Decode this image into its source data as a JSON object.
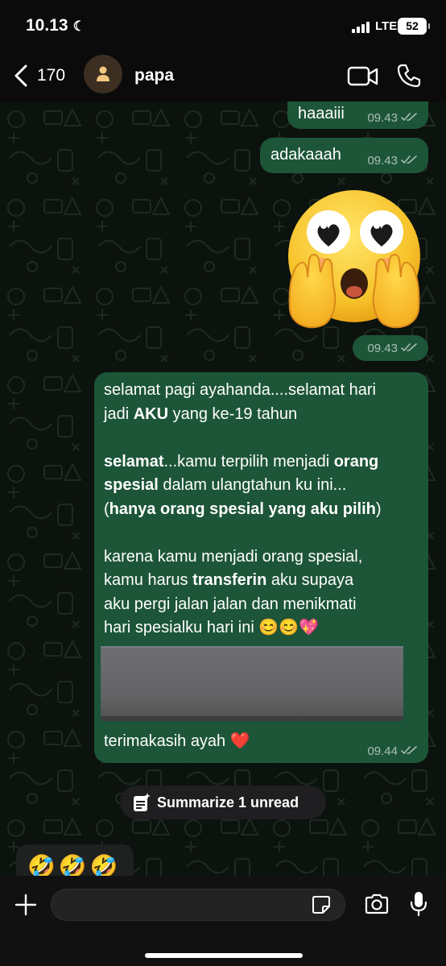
{
  "status_bar": {
    "time": "10.13",
    "network": "LTE",
    "battery": "52",
    "icons": [
      "moon-icon",
      "signal-icon",
      "battery-icon"
    ]
  },
  "header": {
    "back_count": "170",
    "contact_name": "papa",
    "icons": [
      "chevron-left-icon",
      "person-icon",
      "video-icon",
      "phone-icon"
    ]
  },
  "messages": [
    {
      "text": "haaaiii",
      "time": "09.43",
      "status": "read"
    },
    {
      "text": "adakaaah",
      "time": "09.43",
      "status": "read"
    },
    {
      "sticker": "face-holding-back-tears-with-hands-emoji",
      "time": "09.43",
      "status": "read"
    },
    {
      "lines": [
        "selamat pagi ayahanda....selamat hari",
        "jadi **AKU** yang ke-19 tahun",
        "",
        "**selamat**...kamu terpilih menjadi **orang**",
        "**spesial** dalam ulangtahun ku ini...",
        "(**hanya orang spesial yang aku pilih**)",
        "",
        "karena kamu menjadi orang spesial,",
        "kamu harus **transferin** aku supaya",
        "aku pergi jalan jalan dan menikmati",
        "hari spesialku hari ini 😊😊💖"
      ],
      "footer_text": "terimakasih ayah ❤️",
      "time": "09.44",
      "status": "read",
      "has_attachment": true
    }
  ],
  "summarize_button": {
    "label": "Summarize 1 unread",
    "icon": "sparkle-note-icon"
  },
  "incoming_message": {
    "text": "🤣🤣🤣"
  },
  "input_bar": {
    "placeholder": "",
    "icons": [
      "plus-icon",
      "sticker-icon",
      "camera-icon",
      "microphone-icon"
    ]
  },
  "colors": {
    "outgoing_bubble": "#1d5538",
    "incoming_bubble": "#1f2020",
    "chat_background": "#0c120d",
    "bar_background": "#0b0b0b"
  }
}
